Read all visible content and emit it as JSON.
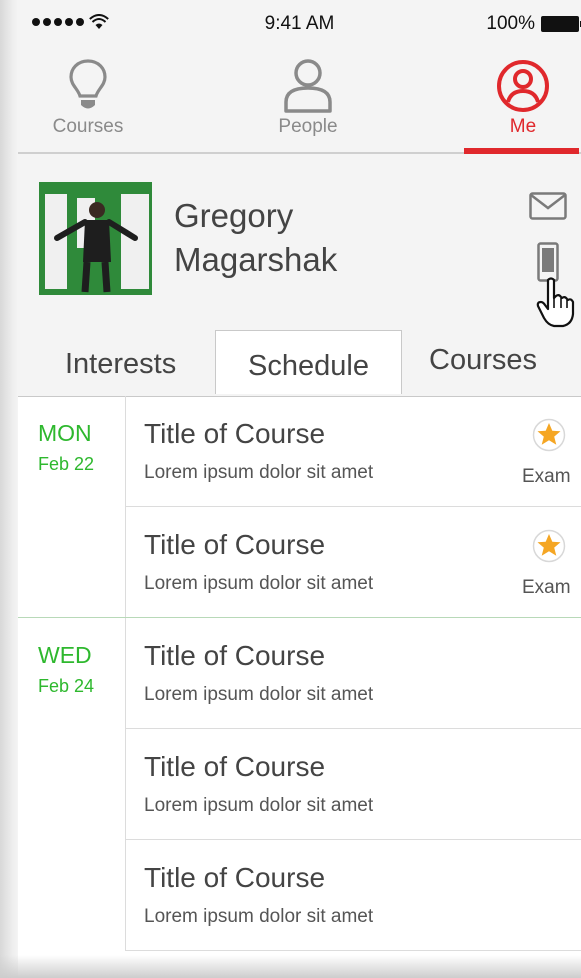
{
  "status_bar": {
    "time": "9:41 AM",
    "battery_text": "100%",
    "icons": [
      "signal-dots-icon",
      "wifi-icon",
      "battery-icon"
    ]
  },
  "tab_bar": {
    "tabs": [
      {
        "label": "Courses",
        "icon": "lightbulb-icon",
        "active": false
      },
      {
        "label": "People",
        "icon": "person-icon",
        "active": false
      },
      {
        "label": "Me",
        "icon": "user-circle-icon",
        "active": true
      }
    ],
    "accent": "#e0282c"
  },
  "profile": {
    "first_name": "Gregory",
    "last_name": "Magarshak",
    "icons": [
      "mail-icon",
      "phone-icon",
      "pointer-hand-icon"
    ]
  },
  "section_tabs": [
    {
      "label": "Interests",
      "active": false
    },
    {
      "label": "Schedule",
      "active": true
    },
    {
      "label": "Courses",
      "active": false
    }
  ],
  "schedule": {
    "accent": "#2eb82e",
    "days": [
      {
        "dow": "MON",
        "date": "Feb 22",
        "items": [
          {
            "title": "Title of Course",
            "desc": "Lorem ipsum dolor sit amet",
            "badge": "Exam"
          },
          {
            "title": "Title of Course",
            "desc": "Lorem ipsum dolor sit amet",
            "badge": "Exam"
          }
        ]
      },
      {
        "dow": "WED",
        "date": "Feb 24",
        "items": [
          {
            "title": "Title of Course",
            "desc": "Lorem ipsum dolor sit amet",
            "badge": ""
          },
          {
            "title": "Title of Course",
            "desc": "Lorem ipsum dolor sit amet",
            "badge": ""
          },
          {
            "title": "Title of Course",
            "desc": "Lorem ipsum dolor sit amet",
            "badge": ""
          }
        ]
      }
    ]
  }
}
